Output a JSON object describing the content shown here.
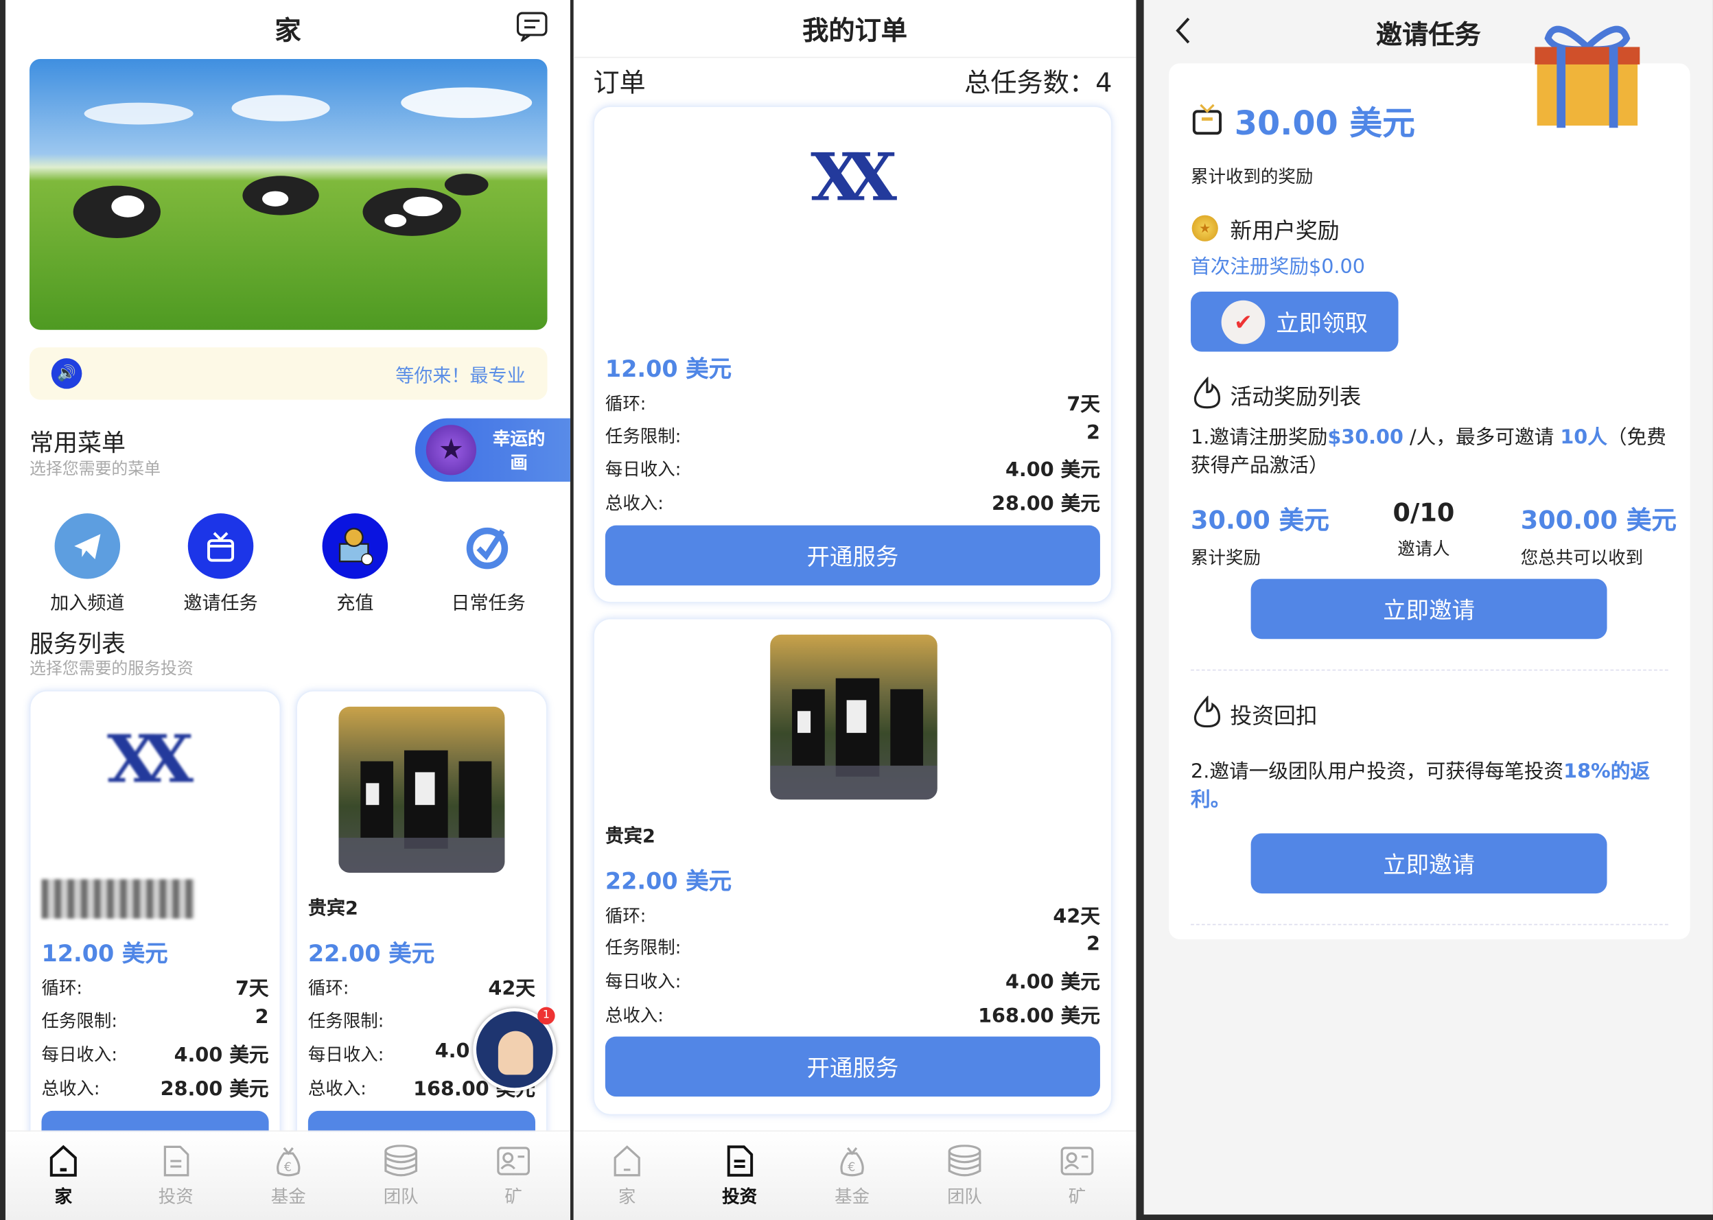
{
  "home": {
    "title": "家",
    "notice": "等你来！最专业",
    "menu_title": "常用菜单",
    "menu_subtitle": "选择您需要的菜单",
    "lucky_label": "幸运的画",
    "menu_items": [
      {
        "label": "加入频道",
        "icon": "telegram-icon"
      },
      {
        "label": "邀请任务",
        "icon": "gift-icon"
      },
      {
        "label": "充值",
        "icon": "deposit-icon"
      },
      {
        "label": "日常任务",
        "icon": "check-badge-icon"
      }
    ],
    "services_title": "服务列表",
    "services_subtitle": "选择您需要的服务投资",
    "products": [
      {
        "name": "",
        "price": "12.00 美元",
        "cycle_label": "循环:",
        "cycle": "7天",
        "limit_label": "任务限制:",
        "limit": "2",
        "daily_label": "每日收入:",
        "daily": "4.00 美元",
        "total_label": "总收入:",
        "total": "28.00 美元"
      },
      {
        "name": "贵宾2",
        "price": "22.00 美元",
        "cycle_label": "循环:",
        "cycle": "42天",
        "limit_label": "任务限制:",
        "limit": "",
        "daily_label": "每日收入:",
        "daily": "4.0",
        "total_label": "总收入:",
        "total": "168.00 美元"
      }
    ],
    "support_badge_count": "1"
  },
  "orders": {
    "title": "我的订单",
    "label": "订单",
    "total_tasks": "总任务数：4",
    "items": [
      {
        "name": "",
        "price": "12.00 美元",
        "cycle_label": "循环:",
        "cycle": "7天",
        "limit_label": "任务限制:",
        "limit": "2",
        "daily_label": "每日收入:",
        "daily": "4.00 美元",
        "total_label": "总收入:",
        "total": "28.00 美元",
        "button": "开通服务"
      },
      {
        "name": "贵宾2",
        "price": "22.00 美元",
        "cycle_label": "循环:",
        "cycle": "42天",
        "limit_label": "任务限制:",
        "limit": "2",
        "daily_label": "每日收入:",
        "daily": "4.00 美元",
        "total_label": "总收入:",
        "total": "168.00 美元",
        "button": "开通服务"
      }
    ]
  },
  "invite": {
    "title": "邀请任务",
    "total_reward": "30.00 美元",
    "total_reward_label": "累计收到的奖励",
    "new_user_title": "新用户奖励",
    "new_user_desc": "首次注册奖励$0.00",
    "claim_button": "立即领取",
    "activity_title": "活动奖励列表",
    "rule1_a": "1.邀请注册奖励",
    "rule1_amount": "$30.00",
    "rule1_b": " /人，最多可邀请 ",
    "rule1_count": "10人",
    "rule1_c": "（免费获得产品激活）",
    "stats": [
      {
        "value": "30.00 美元",
        "label": "累计奖励"
      },
      {
        "value": "0/10",
        "label": "邀请人"
      },
      {
        "value": "300.00 美元",
        "label": "您总共可以收到"
      }
    ],
    "invite_button": "立即邀请",
    "rebate_title": "投资回扣",
    "rule2_a": "2.邀请一级团队用户投资，可获得每笔投资",
    "rule2_b": "18%的返利。",
    "invite_button2": "立即邀请"
  },
  "nav": {
    "items": [
      {
        "label": "家",
        "icon": "home-icon"
      },
      {
        "label": "投资",
        "icon": "document-icon"
      },
      {
        "label": "基金",
        "icon": "money-bag-icon"
      },
      {
        "label": "团队",
        "icon": "coins-stack-icon"
      },
      {
        "label": "矿",
        "icon": "id-card-icon"
      }
    ]
  },
  "colors": {
    "accent": "#5286e6",
    "notice_bg": "#fdf9e6"
  }
}
